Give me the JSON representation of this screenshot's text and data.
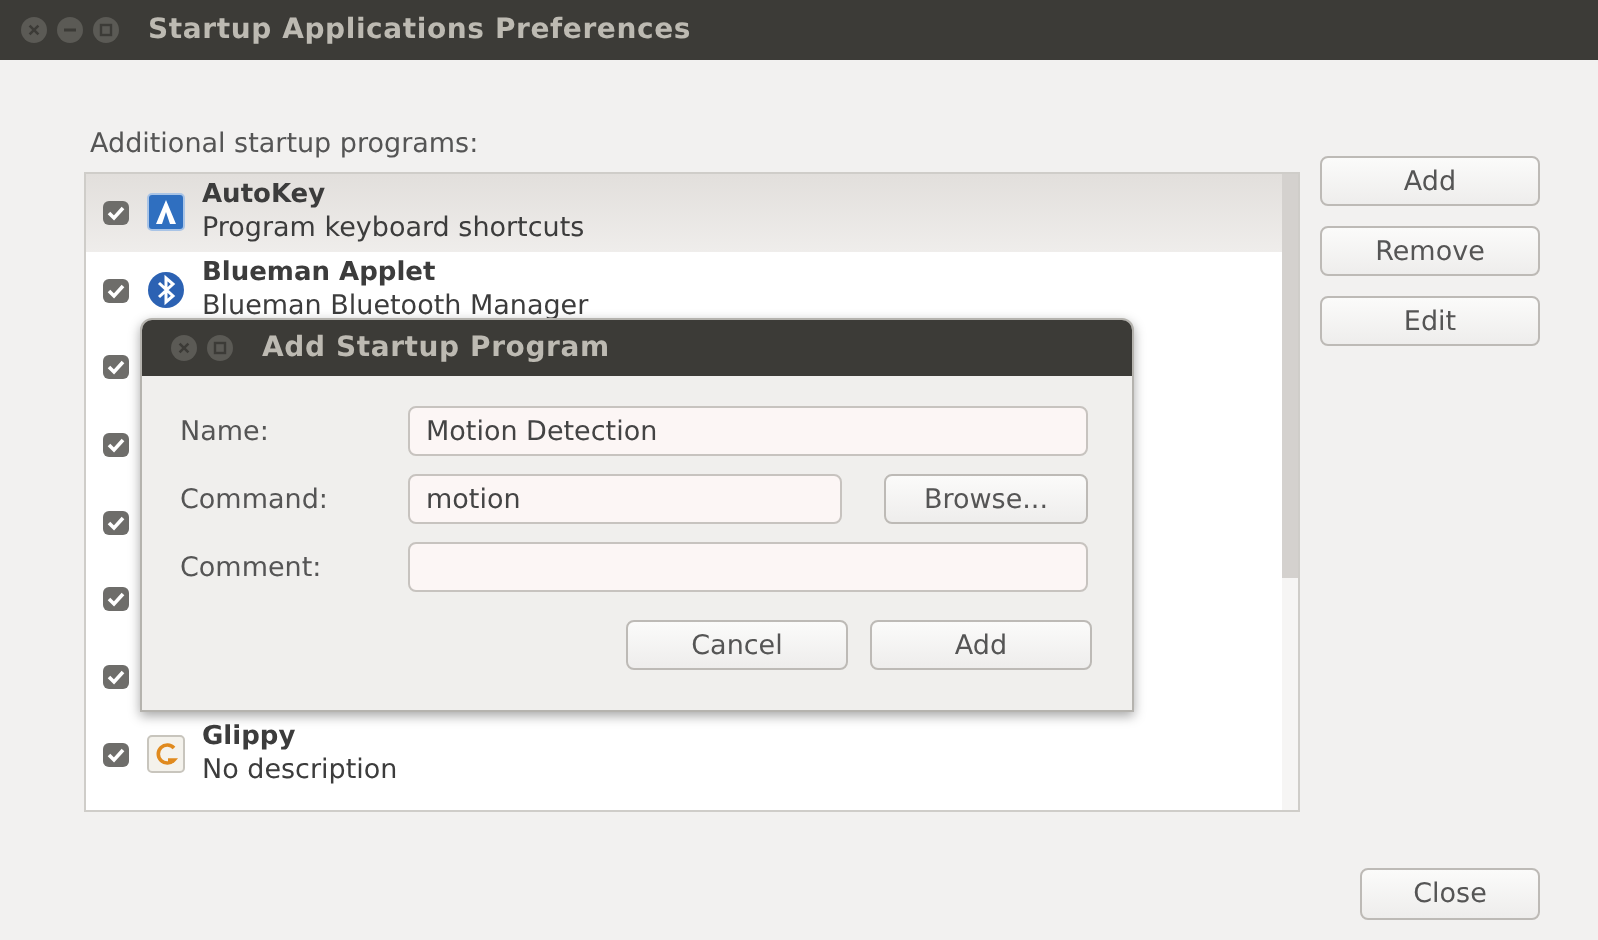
{
  "window": {
    "title": "Startup Applications Preferences"
  },
  "list_label": "Additional startup programs:",
  "programs": [
    {
      "kind": "blue-tile",
      "name": "AutoKey",
      "description": "Program keyboard shortcuts",
      "checked": true,
      "selected": true
    },
    {
      "kind": "round",
      "name": "Blueman Applet",
      "description": "Blueman Bluetooth Manager",
      "checked": true,
      "selected": false
    },
    {
      "kind": "hidden",
      "checked": true
    },
    {
      "kind": "hidden",
      "checked": true
    },
    {
      "kind": "hidden",
      "checked": true
    },
    {
      "kind": "hidden",
      "checked": true
    },
    {
      "kind": "hidden",
      "checked": true
    },
    {
      "kind": "pale-tile",
      "name": "Glippy",
      "description": "No description",
      "checked": true,
      "selected": false
    }
  ],
  "side_buttons": [
    "Add",
    "Remove",
    "Edit"
  ],
  "close_button": "Close",
  "dialog": {
    "title": "Add Startup Program",
    "fields": [
      {
        "label": "Name:",
        "value": "Motion Detection"
      },
      {
        "label": "Command:",
        "value": "motion",
        "button": "Browse..."
      },
      {
        "label": "Comment:"
      }
    ],
    "buttons": [
      "Cancel",
      "Add"
    ]
  }
}
